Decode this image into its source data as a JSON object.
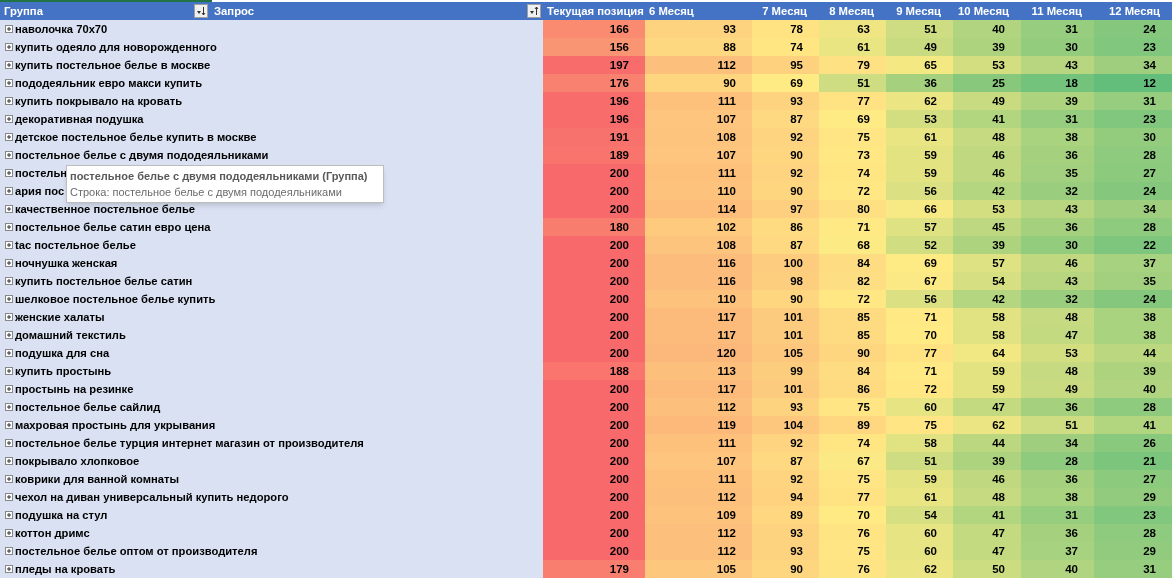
{
  "columns": [
    {
      "label": "Группа",
      "ascending": false
    },
    {
      "label": "Запрос",
      "ascending": true
    },
    {
      "label": "Текущая позиция"
    },
    {
      "label": "6 Месяц"
    },
    {
      "label": "7 Месяц"
    },
    {
      "label": "8 Месяц"
    },
    {
      "label": "9 Месяц"
    },
    {
      "label": "10 Месяц"
    },
    {
      "label": "11 Месяц"
    },
    {
      "label": "12 Месяц"
    }
  ],
  "rows": [
    {
      "group": "наволочка 70x70",
      "values": [
        "166",
        "93",
        "78",
        "63",
        "51",
        "40",
        "31",
        "24"
      ]
    },
    {
      "group": "купить одеяло для новорожденного",
      "values": [
        "156",
        "88",
        "74",
        "61",
        "49",
        "39",
        "30",
        "23"
      ]
    },
    {
      "group": "купить постельное белье в москве",
      "values": [
        "197",
        "112",
        "95",
        "79",
        "65",
        "53",
        "43",
        "34"
      ]
    },
    {
      "group": "пододеяльник евро макси купить",
      "values": [
        "176",
        "90",
        "69",
        "51",
        "36",
        "25",
        "18",
        "12"
      ]
    },
    {
      "group": "купить покрывало на кровать",
      "values": [
        "196",
        "111",
        "93",
        "77",
        "62",
        "49",
        "39",
        "31"
      ]
    },
    {
      "group": "декоративная подушка",
      "values": [
        "196",
        "107",
        "87",
        "69",
        "53",
        "41",
        "31",
        "23"
      ]
    },
    {
      "group": "детское постельное белье купить в москве",
      "values": [
        "191",
        "108",
        "92",
        "75",
        "61",
        "48",
        "38",
        "30"
      ]
    },
    {
      "group": "постельное белье с двумя пододеяльниками",
      "values": [
        "189",
        "107",
        "90",
        "73",
        "59",
        "46",
        "36",
        "28"
      ]
    },
    {
      "group": "постельн",
      "values": [
        "200",
        "111",
        "92",
        "74",
        "59",
        "46",
        "35",
        "27"
      ]
    },
    {
      "group": "ария пос",
      "values": [
        "200",
        "110",
        "90",
        "72",
        "56",
        "42",
        "32",
        "24"
      ]
    },
    {
      "group": "качественное постельное белье",
      "values": [
        "200",
        "114",
        "97",
        "80",
        "66",
        "53",
        "43",
        "34"
      ]
    },
    {
      "group": "постельное белье сатин евро цена",
      "values": [
        "180",
        "102",
        "86",
        "71",
        "57",
        "45",
        "36",
        "28"
      ]
    },
    {
      "group": "tac постельное белье",
      "values": [
        "200",
        "108",
        "87",
        "68",
        "52",
        "39",
        "30",
        "22"
      ]
    },
    {
      "group": "ночнушка женская",
      "values": [
        "200",
        "116",
        "100",
        "84",
        "69",
        "57",
        "46",
        "37"
      ]
    },
    {
      "group": "купить постельное белье сатин",
      "values": [
        "200",
        "116",
        "98",
        "82",
        "67",
        "54",
        "43",
        "35"
      ]
    },
    {
      "group": "шелковое постельное белье купить",
      "values": [
        "200",
        "110",
        "90",
        "72",
        "56",
        "42",
        "32",
        "24"
      ]
    },
    {
      "group": "женские халаты",
      "values": [
        "200",
        "117",
        "101",
        "85",
        "71",
        "58",
        "48",
        "38"
      ]
    },
    {
      "group": "домашний текстиль",
      "values": [
        "200",
        "117",
        "101",
        "85",
        "70",
        "58",
        "47",
        "38"
      ]
    },
    {
      "group": "подушка для сна",
      "values": [
        "200",
        "120",
        "105",
        "90",
        "77",
        "64",
        "53",
        "44"
      ]
    },
    {
      "group": "купить простынь",
      "values": [
        "188",
        "113",
        "99",
        "84",
        "71",
        "59",
        "48",
        "39"
      ]
    },
    {
      "group": "простынь на резинке",
      "values": [
        "200",
        "117",
        "101",
        "86",
        "72",
        "59",
        "49",
        "40"
      ]
    },
    {
      "group": "постельное белье сайлид",
      "values": [
        "200",
        "112",
        "93",
        "75",
        "60",
        "47",
        "36",
        "28"
      ]
    },
    {
      "group": "махровая простынь для укрывания",
      "values": [
        "200",
        "119",
        "104",
        "89",
        "75",
        "62",
        "51",
        "41"
      ]
    },
    {
      "group": "постельное белье турция интернет магазин от производителя",
      "values": [
        "200",
        "111",
        "92",
        "74",
        "58",
        "44",
        "34",
        "26"
      ]
    },
    {
      "group": "покрывало хлопковое",
      "values": [
        "200",
        "107",
        "87",
        "67",
        "51",
        "39",
        "28",
        "21"
      ]
    },
    {
      "group": "коврики для ванной комнаты",
      "values": [
        "200",
        "111",
        "92",
        "75",
        "59",
        "46",
        "36",
        "27"
      ]
    },
    {
      "group": "чехол на диван универсальный купить недорого",
      "values": [
        "200",
        "112",
        "94",
        "77",
        "61",
        "48",
        "38",
        "29"
      ]
    },
    {
      "group": "подушка на стул",
      "values": [
        "200",
        "109",
        "89",
        "70",
        "54",
        "41",
        "31",
        "23"
      ]
    },
    {
      "group": "коттон дримс",
      "values": [
        "200",
        "112",
        "93",
        "76",
        "60",
        "47",
        "36",
        "28"
      ]
    },
    {
      "group": "постельное белье оптом от производителя",
      "values": [
        "200",
        "112",
        "93",
        "75",
        "60",
        "47",
        "37",
        "29"
      ]
    },
    {
      "group": "пледы на кровать",
      "values": [
        "179",
        "105",
        "90",
        "76",
        "62",
        "50",
        "40",
        "31"
      ]
    }
  ],
  "tooltip": {
    "title": "постельное белье с двумя пододеяльниками (Группа)",
    "text": "Строка: постельное белье с двумя пододеяльниками"
  }
}
